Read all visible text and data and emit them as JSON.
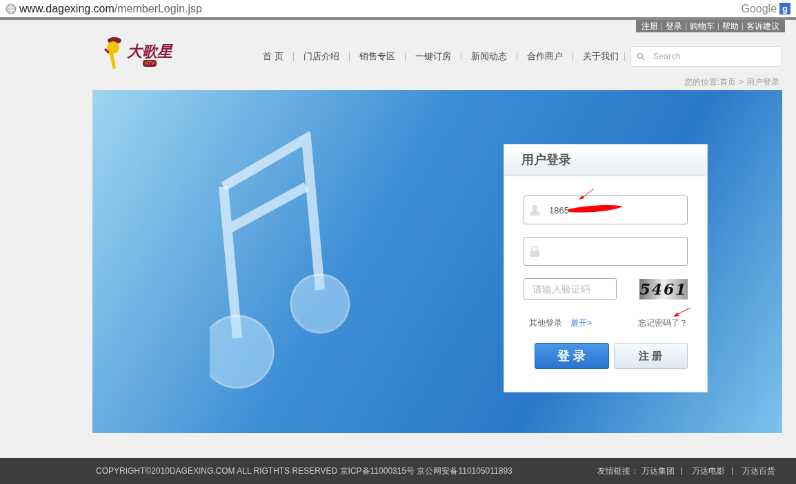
{
  "browser": {
    "url_host": "www.dagexing.com",
    "url_path": "/memberLogin.jsp",
    "search_engine": "Google",
    "search_badge": "g"
  },
  "top_links": [
    "注册",
    "登录",
    "购物车",
    "帮助",
    "客诉建议"
  ],
  "logo": {
    "text": "大歌星",
    "tag": "KTV"
  },
  "nav": [
    "首 页",
    "门店介绍",
    "销售专区",
    "一键订房",
    "新闻动态",
    "合作商户",
    "关于我们"
  ],
  "search": {
    "placeholder": "Search"
  },
  "breadcrumb": {
    "prefix": "您的位置:首页",
    "separator": ">",
    "current": "用户登录"
  },
  "login": {
    "title": "用户登录",
    "username": "1865",
    "captcha_placeholder": "请输入验证码",
    "captcha": "5461",
    "other_login": "其他登录",
    "expand": "展开>",
    "forgot": "忘记密码了？",
    "submit": "登 录",
    "register": "注 册"
  },
  "footer": {
    "copyright": "COPYRIGHT©2010DAGEXING.COM ALL RIGTHTS RESERVED 京ICP备11000315号 京公网安备110105011893",
    "links_label": "友情链接：",
    "links": [
      "万达集团",
      "万达电影",
      "万达百货"
    ]
  }
}
